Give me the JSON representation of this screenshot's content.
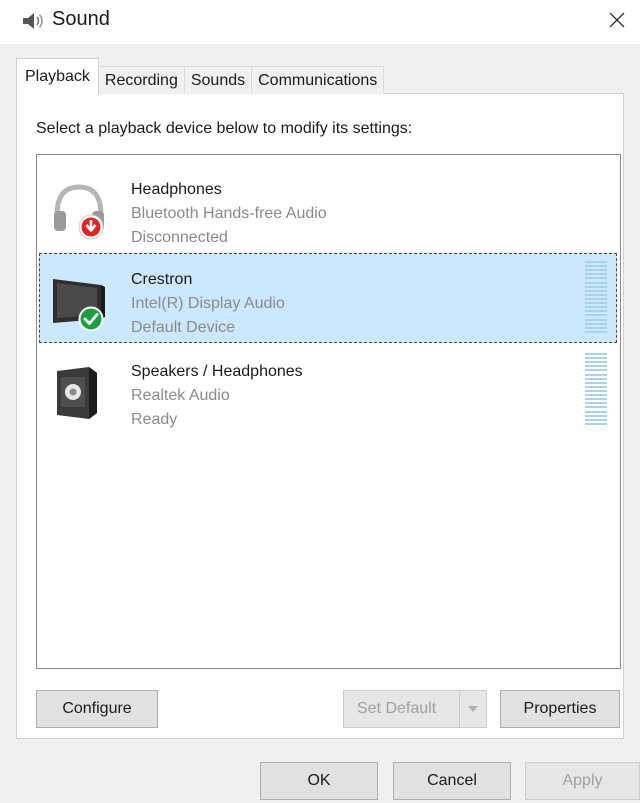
{
  "window": {
    "title": "Sound",
    "close_icon": "close-icon"
  },
  "tabs": [
    {
      "label": "Playback",
      "active": true
    },
    {
      "label": "Recording",
      "active": false
    },
    {
      "label": "Sounds",
      "active": false
    },
    {
      "label": "Communications",
      "active": false
    }
  ],
  "instruction": "Select a playback device below to modify its settings:",
  "devices": [
    {
      "name": "Headphones",
      "description": "Bluetooth Hands-free Audio",
      "status": "Disconnected",
      "icon": "headphones-icon",
      "badge": "disconnected-badge",
      "selected": false,
      "meter": false
    },
    {
      "name": "Crestron",
      "description": "Intel(R) Display Audio",
      "status": "Default Device",
      "icon": "monitor-icon",
      "badge": "default-check-badge",
      "selected": true,
      "meter": true
    },
    {
      "name": "Speakers / Headphones",
      "description": "Realtek Audio",
      "status": "Ready",
      "icon": "speaker-icon",
      "badge": "",
      "selected": false,
      "meter": true
    }
  ],
  "buttons": {
    "configure": "Configure",
    "set_default": "Set Default",
    "properties": "Properties",
    "ok": "OK",
    "cancel": "Cancel",
    "apply": "Apply"
  },
  "colors": {
    "selection": "#cce8ff",
    "meter": "#a8d3ea",
    "check_badge": "#1e9e3e",
    "disconnect_badge": "#e02424"
  }
}
